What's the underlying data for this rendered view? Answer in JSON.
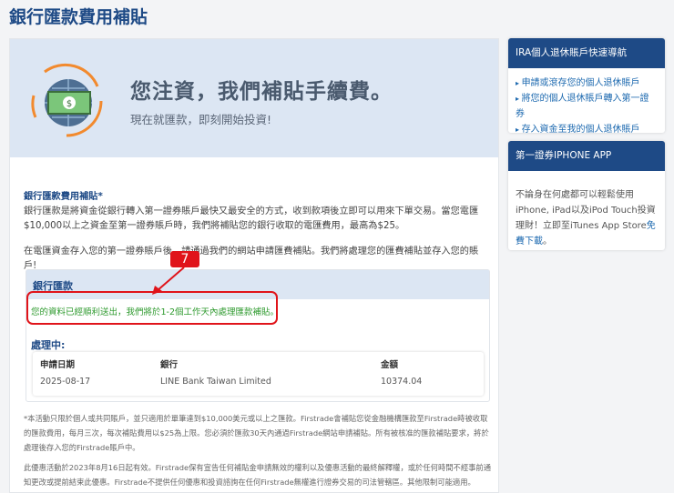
{
  "page_title": "銀行匯款費用補貼",
  "hero": {
    "headline": "您注資，我們補貼手續費。",
    "subline": "現在就匯款，即刻開始投資!"
  },
  "intro": {
    "heading": "銀行匯款費用補貼*",
    "para1": "銀行匯款是將資金從銀行轉入第一證券賬戶最快又最安全的方式，收到款項後立即可以用來下單交易。當您電匯$10,000以上之資金至第一證券賬戶時，我們將補貼您的銀行收取的電匯費用，最高為$25。",
    "para2": "在電匯資金存入您的第一證券賬戶後，請通過我們的網站申請匯費補貼。我們將處理您的匯費補貼並存入您的賬戶!"
  },
  "annotation": {
    "label": "7",
    "color": "#e0141a"
  },
  "panel": {
    "title": "銀行匯款",
    "success": "您的資料已經順利送出，我們將於1-2個工作天內處理匯款補貼。",
    "processing": "處理中:",
    "columns": [
      "申請日期",
      "銀行",
      "金額"
    ],
    "rows": [
      [
        "2025-08-17",
        "LINE Bank Taiwan Limited",
        "10374.04"
      ]
    ]
  },
  "footnotes": [
    "*本活動只限於個人或共同賬戶，並只適用於單筆達到$10,000美元或以上之匯款。Firstrade會補貼您從金融機構匯款至Firstrade時被收取的匯款費用，每月三次，每次補貼費用以$25為上限。您必須於匯款30天內通過Firstrade網站申請補貼。所有被核准的匯款補貼要求，將於處理後存入您的Firstrade賬戶中。",
    "此優惠活動於2023年8月16日起有效。Firstrade保有宣告任何補貼金申請無效的權利以及優惠活動的最終解釋權，或於任何時間不經事前通知更改或提前結束此優惠。Firstrade不提供任何優惠和投資諮詢在任何Firstrade無權進行證券交易的司法管轄區。其他限制可能適用。"
  ],
  "sidebar": {
    "ira": {
      "title": "IRA個人退休賬戶快速導航",
      "links": [
        "申請或滾存您的個人退休賬戶",
        "將您的個人退休賬戶轉入第一證券",
        "存入資金至我的個人退休賬戶"
      ]
    },
    "app": {
      "title": "第一證券IPHONE APP",
      "text": "不論身在何處都可以輕鬆使用iPhone, iPad以及iPod Touch投資理財！立即至iTunes App Store",
      "link": "免費下載",
      "tail": "。"
    }
  }
}
